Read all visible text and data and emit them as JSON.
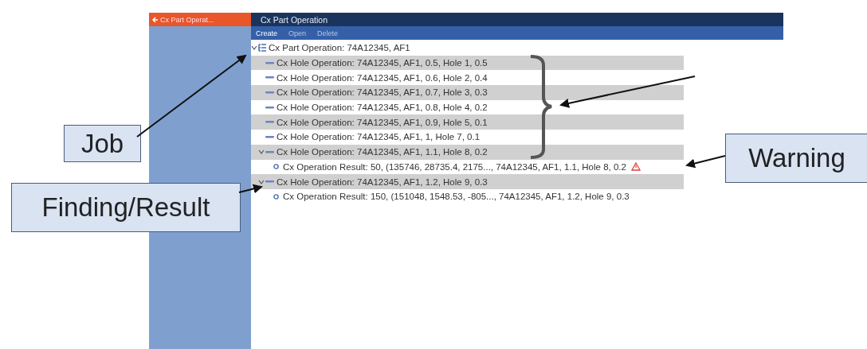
{
  "window": {
    "back_tab": "Cx Part Operat...",
    "title": "Cx Part Operation"
  },
  "toolbar": [
    {
      "label": "Create",
      "disabled": false
    },
    {
      "label": "Open",
      "disabled": true
    },
    {
      "label": "Delete",
      "disabled": true
    }
  ],
  "tree": [
    {
      "label": "Cx Part Operation: 74A12345, AF1",
      "kind": "part",
      "expanded": true,
      "children": [
        {
          "label": "Cx Hole Operation: 74A12345, AF1, 0.5, Hole 1, 0.5",
          "kind": "hole",
          "expanded": false
        },
        {
          "label": "Cx Hole Operation: 74A12345, AF1, 0.6, Hole 2, 0.4",
          "kind": "hole",
          "expanded": false
        },
        {
          "label": "Cx Hole Operation: 74A12345, AF1, 0.7, Hole 3, 0.3",
          "kind": "hole",
          "expanded": false
        },
        {
          "label": "Cx Hole Operation: 74A12345, AF1, 0.8, Hole 4, 0.2",
          "kind": "hole",
          "expanded": false
        },
        {
          "label": "Cx Hole Operation: 74A12345, AF1, 0.9, Hole 5, 0.1",
          "kind": "hole",
          "expanded": false
        },
        {
          "label": "Cx Hole Operation: 74A12345, AF1, 1, Hole 7, 0.1",
          "kind": "hole",
          "expanded": false
        },
        {
          "label": "Cx Hole Operation: 74A12345, AF1, 1.1, Hole 8, 0.2",
          "kind": "hole",
          "expanded": true,
          "children": [
            {
              "label": "Cx Operation Result: 50, (135746, 28735.4, 2175..., 74A12345, AF1, 1.1, Hole 8, 0.2",
              "kind": "result",
              "warning": true
            }
          ]
        },
        {
          "label": "Cx Hole Operation: 74A12345, AF1, 1.2, Hole 9, 0.3",
          "kind": "hole",
          "expanded": true,
          "children": [
            {
              "label": "Cx Operation Result: 150, (151048, 1548.53, -805..., 74A12345, AF1, 1.2, Hole 9, 0.3",
              "kind": "result",
              "warning": false
            }
          ]
        }
      ]
    }
  ],
  "annotations": [
    {
      "label": "Job"
    },
    {
      "label": "Finding/Result"
    },
    {
      "label": "Warning"
    }
  ]
}
